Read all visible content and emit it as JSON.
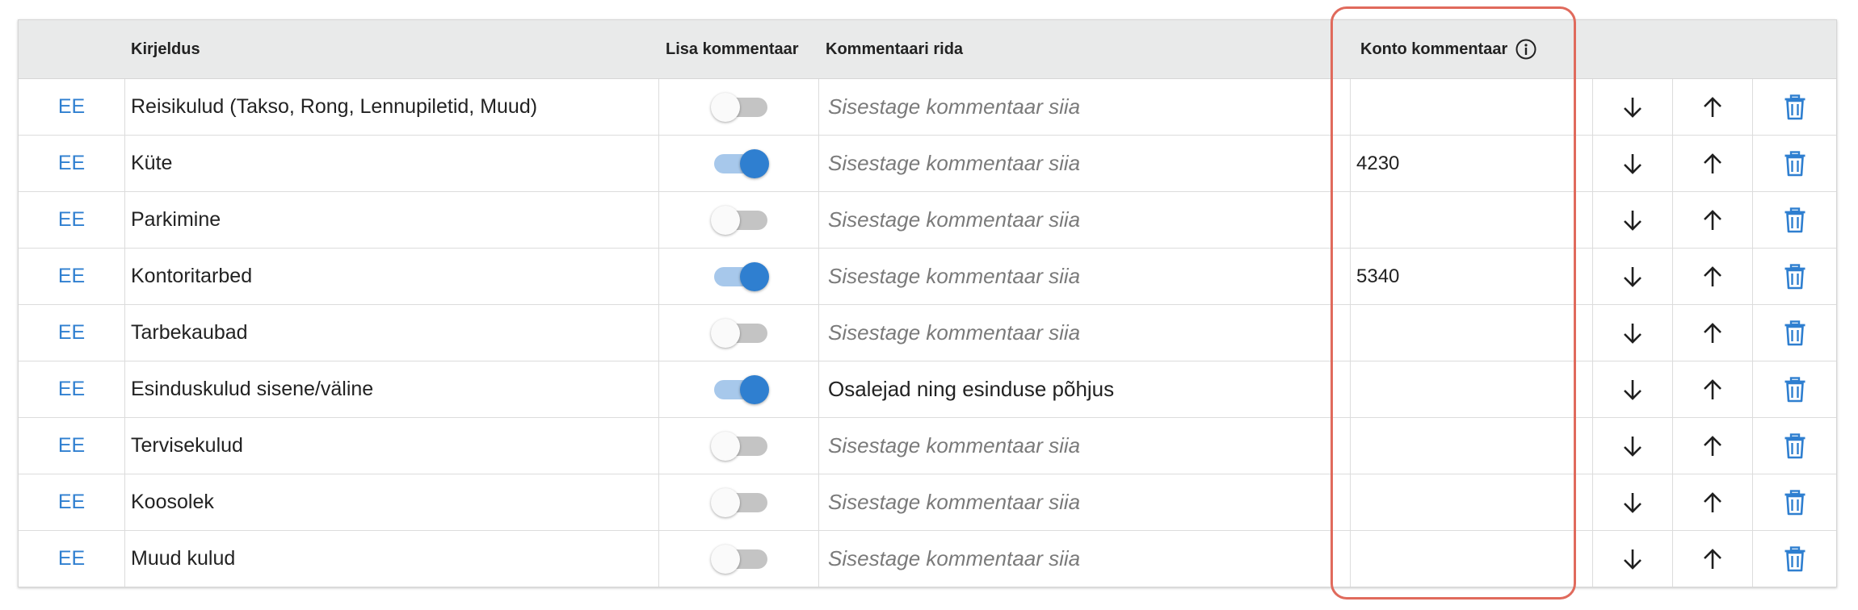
{
  "header": {
    "kirjeldus": "Kirjeldus",
    "lisa_kommentaar": "Lisa kommentaar",
    "kommentaari_rida": "Kommentaari rida",
    "konto_kommentaar": "Konto kommentaar"
  },
  "icons": {
    "info": "info-icon",
    "down": "arrow-down-icon",
    "up": "arrow-up-icon",
    "delete": "trash-icon"
  },
  "colors": {
    "accent": "#2f7fd0",
    "highlight": "#e06a5c",
    "header_bg": "#e9eaea"
  },
  "rows": [
    {
      "lang": "EE",
      "description": "Reisikulud (Takso, Rong, Lennupiletid, Muud)",
      "toggle_on": false,
      "comment_value": "",
      "comment_placeholder": "Sisestage kommentaar siia",
      "account": ""
    },
    {
      "lang": "EE",
      "description": "Küte",
      "toggle_on": true,
      "comment_value": "",
      "comment_placeholder": "Sisestage kommentaar siia",
      "account": "4230"
    },
    {
      "lang": "EE",
      "description": "Parkimine",
      "toggle_on": false,
      "comment_value": "",
      "comment_placeholder": "Sisestage kommentaar siia",
      "account": ""
    },
    {
      "lang": "EE",
      "description": "Kontoritarbed",
      "toggle_on": true,
      "comment_value": "",
      "comment_placeholder": "Sisestage kommentaar siia",
      "account": "5340"
    },
    {
      "lang": "EE",
      "description": "Tarbekaubad",
      "toggle_on": false,
      "comment_value": "",
      "comment_placeholder": "Sisestage kommentaar siia",
      "account": ""
    },
    {
      "lang": "EE",
      "description": "Esinduskulud sisene/väline",
      "toggle_on": true,
      "comment_value": "Osalejad ning esinduse põhjus",
      "comment_placeholder": "Sisestage kommentaar siia",
      "account": ""
    },
    {
      "lang": "EE",
      "description": "Tervisekulud",
      "toggle_on": false,
      "comment_value": "",
      "comment_placeholder": "Sisestage kommentaar siia",
      "account": ""
    },
    {
      "lang": "EE",
      "description": "Koosolek",
      "toggle_on": false,
      "comment_value": "",
      "comment_placeholder": "Sisestage kommentaar siia",
      "account": ""
    },
    {
      "lang": "EE",
      "description": "Muud kulud",
      "toggle_on": false,
      "comment_value": "",
      "comment_placeholder": "Sisestage kommentaar siia",
      "account": ""
    }
  ]
}
